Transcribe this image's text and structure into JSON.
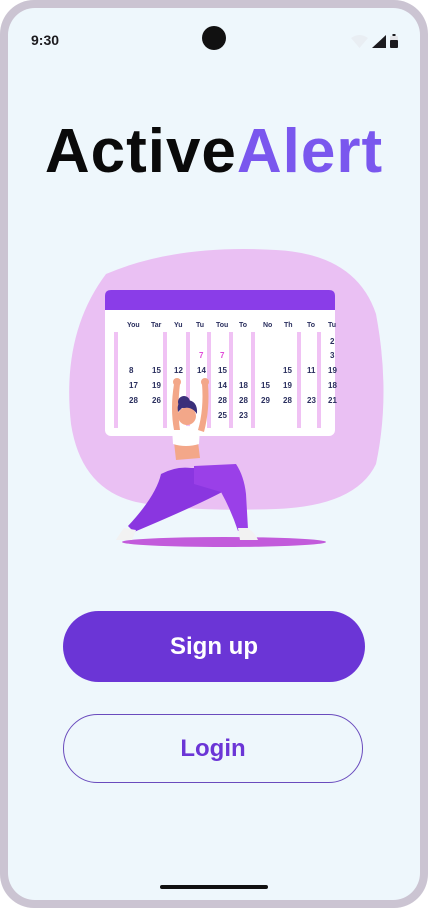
{
  "status_bar": {
    "time": "9:30",
    "icons": [
      "wifi-icon",
      "cellular-signal-icon",
      "battery-icon"
    ]
  },
  "brand": {
    "title_part1": "Active",
    "title_part2": "Alert",
    "accent_color": "#7a57ee"
  },
  "illustration": {
    "name": "woman-exercising-in-front-of-calendar",
    "calendar_day_headers": [
      "You",
      "Tar",
      "Yu",
      "Tu",
      "Tou",
      "To",
      "No",
      "Th",
      "To",
      "Tu"
    ],
    "calendar_numbers": [
      "2",
      "3",
      "8",
      "15",
      "12",
      "14",
      "15",
      "15",
      "11",
      "19",
      "17",
      "19",
      "14",
      "18",
      "15",
      "19",
      "18",
      "28",
      "26",
      "28",
      "28",
      "29",
      "28",
      "21",
      "23",
      "7",
      "7",
      "25",
      "23"
    ]
  },
  "actions": {
    "signup_label": "Sign up",
    "login_label": "Login",
    "primary_color": "#6b35d6"
  }
}
